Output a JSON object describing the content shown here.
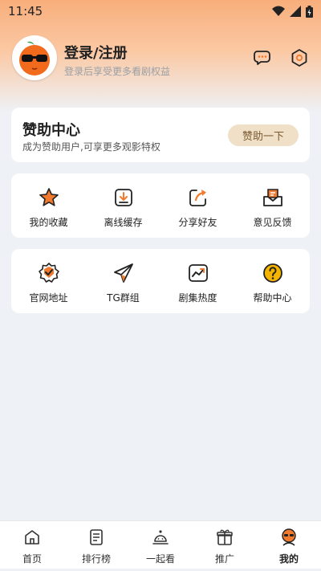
{
  "status_bar": {
    "time": "11:45"
  },
  "profile": {
    "title": "登录/注册",
    "subtitle": "登录后享受更多看剧权益"
  },
  "sponsor": {
    "title": "赞助中心",
    "subtitle": "成为赞助用户,可享更多观影特权",
    "button": "赞助一下"
  },
  "grid1": [
    {
      "label": "我的收藏",
      "icon": "star-icon"
    },
    {
      "label": "离线缓存",
      "icon": "download-icon"
    },
    {
      "label": "分享好友",
      "icon": "share-icon"
    },
    {
      "label": "意见反馈",
      "icon": "feedback-icon"
    }
  ],
  "grid2": [
    {
      "label": "官网地址",
      "icon": "badge-check-icon"
    },
    {
      "label": "TG群组",
      "icon": "telegram-icon"
    },
    {
      "label": "剧集热度",
      "icon": "trend-icon"
    },
    {
      "label": "帮助中心",
      "icon": "help-icon"
    }
  ],
  "tabs": [
    {
      "label": "首页",
      "icon": "home-icon"
    },
    {
      "label": "排行榜",
      "icon": "ranking-icon"
    },
    {
      "label": "一起看",
      "icon": "watch-together-icon"
    },
    {
      "label": "推广",
      "icon": "gift-icon"
    },
    {
      "label": "我的",
      "icon": "profile-icon"
    }
  ],
  "colors": {
    "accent_orange": "#f27a2e",
    "header_gradient_top": "#f8ae7b",
    "sponsor_button_bg": "#f0e0c8",
    "background": "#eef2f7"
  }
}
